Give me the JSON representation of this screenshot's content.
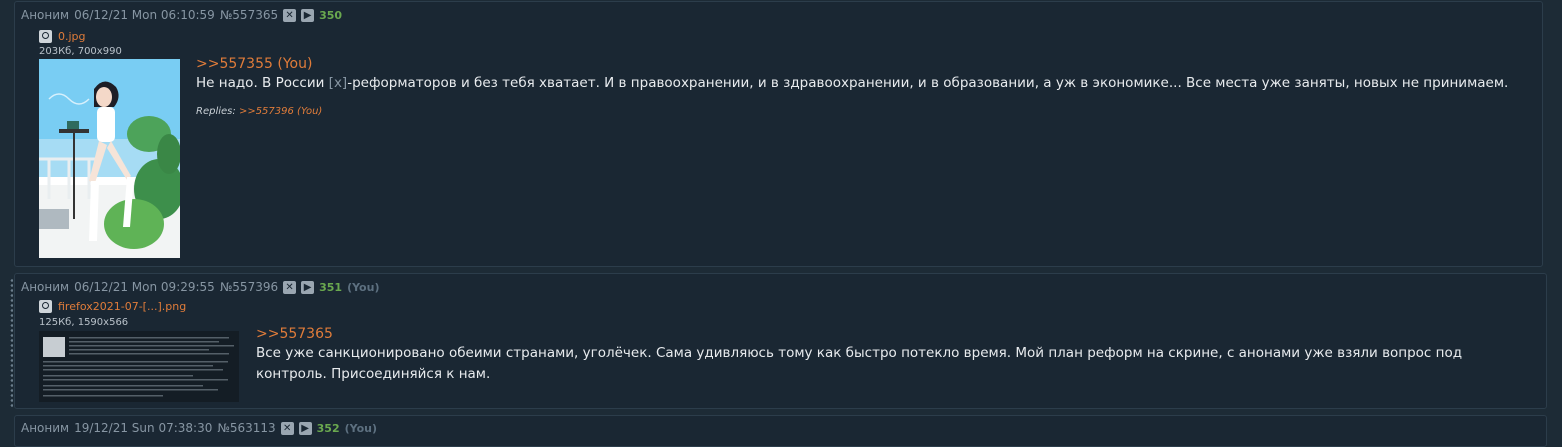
{
  "posts": [
    {
      "author": "Аноним",
      "date": "06/12/21 Mon 06:10:59",
      "post_id": "№557365",
      "number": "350",
      "you": "",
      "file_name": "0.jpg",
      "file_meta": "203Кб, 700x990",
      "reply_to": ">>557355 (You)",
      "text_before": "Не надо. В России ",
      "spoiler": "[x]",
      "text_after": "-реформаторов и без тебя хватает. И в правоохранении, и в здравоохранении, и в образовании, а уж в экономике... Все места уже заняты, новых не принимаем.",
      "replies_label": "Replies:",
      "replies_link": ">>557396 (You)"
    },
    {
      "author": "Аноним",
      "date": "06/12/21 Mon 09:29:55",
      "post_id": "№557396",
      "number": "351",
      "you": "(You)",
      "file_name": "firefox2021-07-[...].png",
      "file_meta": "125Кб, 1590x566",
      "reply_to": ">>557365",
      "text": "Все уже санкционировано обеими странами, уголёчек. Сама удивляюсь тому как быстро потекло время. Мой план реформ на скрине, с анонами уже взяли вопрос под контроль. Присоединяйся к нам."
    },
    {
      "author": "Аноним",
      "date": "19/12/21 Sun 07:38:30",
      "post_id": "№563113",
      "number": "352",
      "you": "(You)"
    }
  ],
  "icons": {
    "hide": "close-box-icon",
    "play": "play-box-icon",
    "search": "magnifier-icon"
  },
  "colors": {
    "background": "#1d2b36",
    "post": "#1a2733",
    "link": "#e07c3a",
    "post_number": "#6aa84f"
  }
}
